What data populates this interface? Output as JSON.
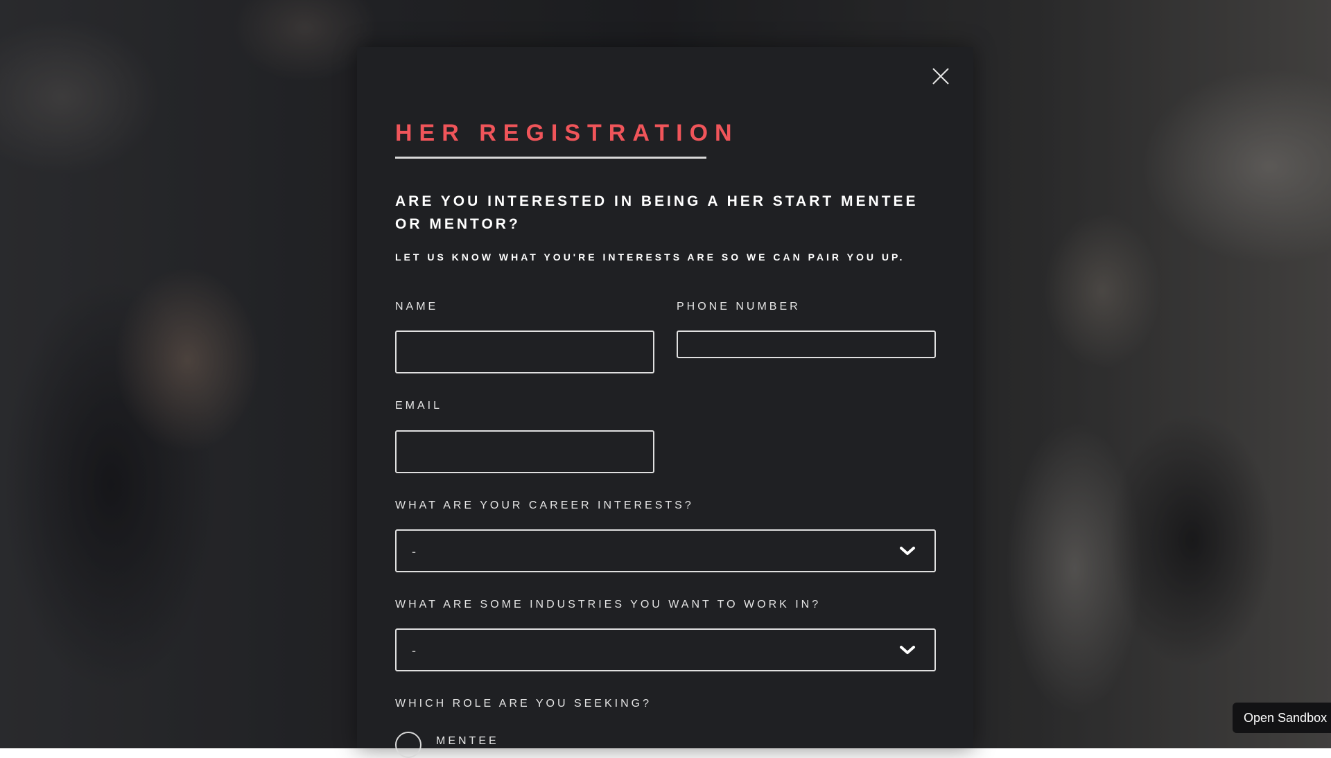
{
  "colors": {
    "accent": "#f0555a",
    "modal_background": "#1f2023",
    "text": "#ffffff",
    "border": "#e0e0e0"
  },
  "modal": {
    "close_icon": "close-icon",
    "title": "HER REGISTRATION",
    "heading": "ARE YOU INTERESTED IN BEING A HER START MENTEE OR MENTOR?",
    "subheading": "LET US KNOW WHAT YOU'RE INTERESTS ARE SO WE CAN PAIR YOU UP."
  },
  "form": {
    "name": {
      "label": "NAME",
      "value": ""
    },
    "phone": {
      "label": "PHONE NUMBER",
      "value": ""
    },
    "email": {
      "label": "EMAIL",
      "value": ""
    },
    "career_interests": {
      "label": "WHAT ARE YOUR CAREER INTERESTS?",
      "selected": "-",
      "icon": "chevron-down-icon"
    },
    "industries": {
      "label": "WHAT ARE SOME INDUSTRIES YOU WANT TO WORK IN?",
      "selected": "-",
      "icon": "chevron-down-icon"
    },
    "role": {
      "label": "WHICH ROLE ARE YOU SEEKING?",
      "options": [
        {
          "label": "MENTEE",
          "selected": false
        }
      ]
    }
  },
  "sandbox": {
    "label": "Open Sandbox"
  }
}
